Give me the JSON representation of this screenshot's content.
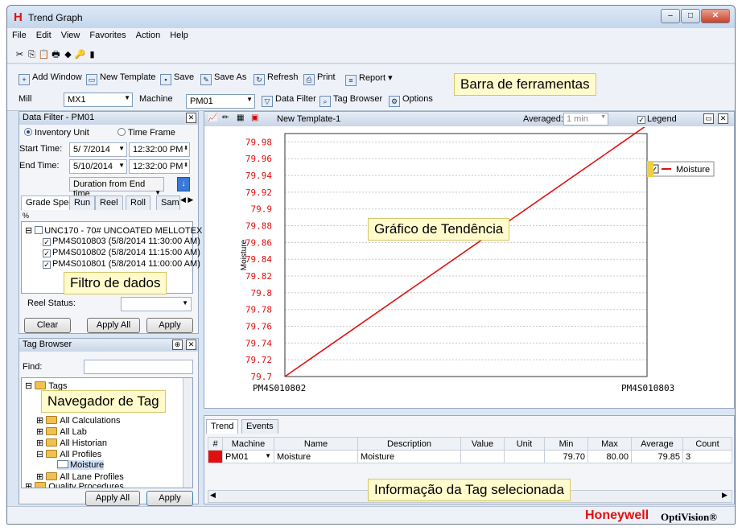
{
  "app": {
    "title": "Trend Graph",
    "logo": "H"
  },
  "window_buttons": {
    "minimize": "–",
    "maximize": "□",
    "close": "✕"
  },
  "menu": [
    "File",
    "Edit",
    "View",
    "Favorites",
    "Action",
    "Help"
  ],
  "iconbar": [
    "✂",
    "⎘",
    "📋",
    "🖶",
    "◆",
    "🔑",
    "▮"
  ],
  "toolbar": {
    "add_window": "Add Window",
    "new_template": "New Template",
    "save": "Save",
    "save_as": "Save As",
    "refresh": "Refresh",
    "print": "Print",
    "report": "Report",
    "mill_label": "Mill",
    "mill_value": "MX1",
    "machine_label": "Machine",
    "machine_value": "PM01",
    "data_filter": "Data Filter",
    "tag_browser": "Tag Browser",
    "options": "Options"
  },
  "callouts": {
    "toolbar": "Barra de ferramentas",
    "chart": "Gráfico de Tendência",
    "filter": "Filtro de dados",
    "browser": "Navegador de Tag",
    "info": "Informação da  Tag selecionada"
  },
  "data_filter": {
    "title": "Data Filter - PM01",
    "radio_inventory": "Inventory Unit",
    "radio_time": "Time Frame",
    "start_label": "Start Time:",
    "start_date": "5/ 7/2014",
    "start_time": "12:32:00 PM",
    "end_label": "End Time:",
    "end_date": "5/10/2014",
    "end_time": "12:32:00 PM",
    "duration": "Duration from End time",
    "tabs": [
      "Grade Spec",
      "Run",
      "Reel",
      "Roll",
      "Sam"
    ],
    "tree_header": "%",
    "tree_root": "UNC170 - 70# UNCOATED MELLOTEX",
    "tree_items": [
      "PM4S010803 (5/8/2014 11:30:00 AM)",
      "PM4S010802 (5/8/2014 11:15:00 AM)",
      "PM4S010801 (5/8/2014 11:00:00 AM)"
    ],
    "reel_status": "Reel Status:",
    "clear": "Clear",
    "apply_all": "Apply All",
    "apply": "Apply"
  },
  "tag_browser": {
    "title": "Tag Browser",
    "find_label": "Find:",
    "root": "Tags",
    "items": [
      "All Calculations",
      "All Lab",
      "All Historian",
      "All Profiles",
      "Moisture",
      "All Lane Profiles",
      "Quality Procedures"
    ],
    "apply_all": "Apply All",
    "apply": "Apply"
  },
  "chart_header": {
    "template": "New Template-1",
    "averaged_label": "Averaged:",
    "averaged_value": "1 min",
    "legend_label": "Legend"
  },
  "chart_data": {
    "type": "line",
    "ylabel": "Moisture",
    "xlabel": "",
    "ylim": [
      79.7,
      79.99
    ],
    "yticks": [
      "79.98",
      "79.96",
      "79.94",
      "79.92",
      "79.9",
      "79.88",
      "79.86",
      "79.84",
      "79.82",
      "79.8",
      "79.78",
      "79.76",
      "79.74",
      "79.72",
      "79.7"
    ],
    "xticks": [
      "PM4S010802",
      "PM4S010803"
    ],
    "series": [
      {
        "name": "Moisture",
        "x": [
          "PM4S010802",
          "PM4S010803"
        ],
        "values": [
          79.7,
          80.0
        ],
        "color": "#e01010"
      }
    ],
    "legend_position": "top-right",
    "grid": true
  },
  "info_panel": {
    "tabs": [
      "Trend",
      "Events"
    ],
    "columns": [
      "#",
      "Machine",
      "Name",
      "Description",
      "Value",
      "Unit",
      "Min",
      "Max",
      "Average",
      "Count"
    ],
    "rows": [
      {
        "color": "#e01010",
        "machine": "PM01",
        "name": "Moisture",
        "description": "Moisture",
        "value": "",
        "unit": "",
        "min": "79.70",
        "max": "80.00",
        "average": "79.85",
        "count": "3"
      }
    ]
  },
  "brand": {
    "name": "Honeywell",
    "product": "OptiVision®"
  }
}
